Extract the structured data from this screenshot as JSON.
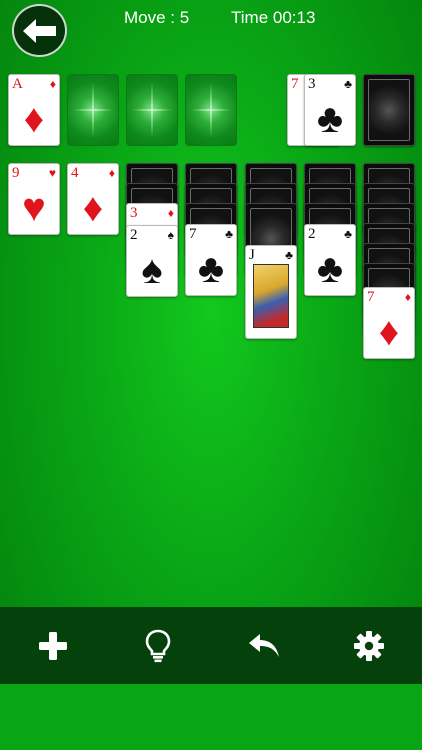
{
  "hud": {
    "move_label": "Move : 5",
    "time_label": "Time 00:13"
  },
  "foundation": [
    {
      "rank": "A",
      "suit": "♦",
      "color": "red"
    },
    null,
    null,
    null
  ],
  "waste": [
    {
      "rank": "7",
      "suit": "♦",
      "color": "red"
    },
    {
      "rank": "3",
      "suit": "♣",
      "color": "black"
    }
  ],
  "tableau": [
    {
      "face_up": [
        {
          "rank": "9",
          "suit": "♥",
          "color": "red"
        }
      ]
    },
    {
      "face_up": [
        {
          "rank": "4",
          "suit": "♦",
          "color": "red"
        }
      ]
    },
    {
      "face_up": [
        {
          "rank": "3",
          "suit": "♦",
          "color": "red"
        },
        {
          "rank": "2",
          "suit": "♠",
          "color": "black"
        }
      ]
    },
    {
      "face_up": [
        {
          "rank": "7",
          "suit": "♣",
          "color": "black"
        }
      ]
    },
    {
      "face_up": [
        {
          "rank": "J",
          "suit": "♣",
          "color": "black"
        }
      ]
    },
    {
      "face_up": [
        {
          "rank": "2",
          "suit": "♣",
          "color": "black"
        }
      ]
    },
    {
      "face_up": [
        {
          "rank": "7",
          "suit": "♦",
          "color": "red"
        }
      ]
    }
  ],
  "toolbar": {
    "icons": [
      "plus-icon",
      "lightbulb-icon",
      "undo-icon",
      "gear-icon"
    ]
  },
  "colors": {
    "felt": "#0aa816",
    "toolbar": "#05410b",
    "red_suit": "#e0141c"
  }
}
